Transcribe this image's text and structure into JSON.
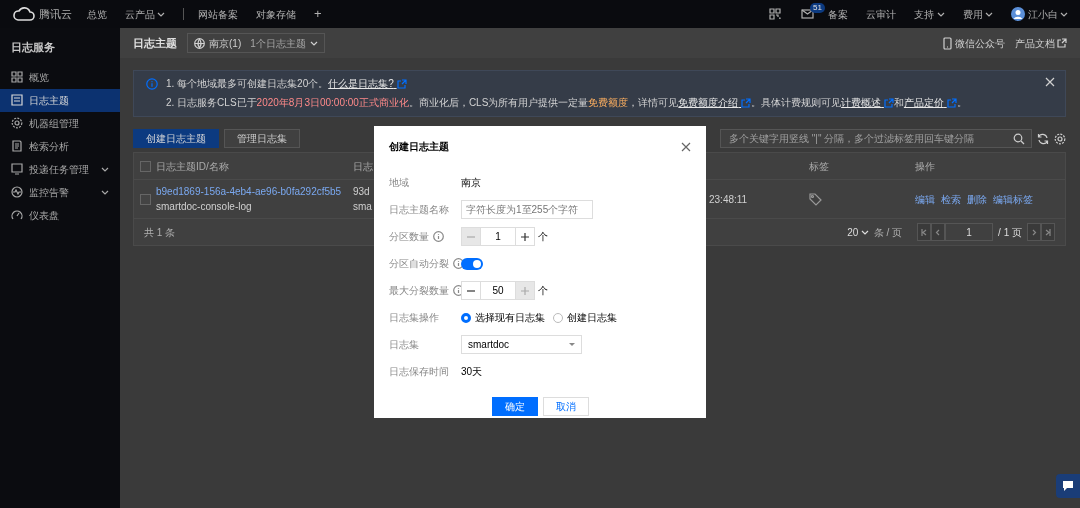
{
  "top_nav": {
    "logo": "腾讯云",
    "left_items": [
      {
        "label": "总览",
        "dropdown": false
      },
      {
        "label": "云产品",
        "dropdown": true
      }
    ],
    "shortcuts": [
      "网站备案",
      "对象存储"
    ],
    "add": "+",
    "mail_badge": "51",
    "right_items": [
      {
        "label": "备案",
        "dropdown": false
      },
      {
        "label": "云审计",
        "dropdown": false
      },
      {
        "label": "支持",
        "dropdown": true
      },
      {
        "label": "费用",
        "dropdown": true
      }
    ],
    "user": {
      "name": "江小白",
      "dropdown": true
    }
  },
  "sidebar": {
    "title": "日志服务",
    "items": [
      {
        "label": "概览",
        "selected": false,
        "expandable": false
      },
      {
        "label": "日志主题",
        "selected": true,
        "expandable": false
      },
      {
        "label": "机器组管理",
        "selected": false,
        "expandable": false
      },
      {
        "label": "检索分析",
        "selected": false,
        "expandable": false
      },
      {
        "label": "投递任务管理",
        "selected": false,
        "expandable": true
      },
      {
        "label": "监控告警",
        "selected": false,
        "expandable": true
      },
      {
        "label": "仪表盘",
        "selected": false,
        "expandable": false
      }
    ]
  },
  "page_header": {
    "title": "日志主题",
    "region": "南京(1)",
    "topic_count": "1个日志主题",
    "links": [
      {
        "label": "微信公众号",
        "kind": "phone"
      },
      {
        "label": "产品文档",
        "kind": "external"
      }
    ]
  },
  "notice": {
    "lines": [
      [
        {
          "kind": "plain",
          "text": "1. 每个地域最多可创建日志集20个。"
        },
        {
          "kind": "link",
          "text": "什么是日志集?"
        }
      ],
      [
        {
          "kind": "plain",
          "text": "2. 日志服务CLS已于"
        },
        {
          "kind": "red",
          "text": "2020年8月3日00:00:00正式商业化"
        },
        {
          "kind": "plain",
          "text": "。商业化后，CLS为所有用户提供一定量"
        },
        {
          "kind": "orange",
          "text": "免费额度"
        },
        {
          "kind": "plain",
          "text": "，详情可见"
        },
        {
          "kind": "link",
          "text": "免费额度介绍"
        },
        {
          "kind": "plain",
          "text": "。具体计费规则可见"
        },
        {
          "kind": "link",
          "text": "计费概述"
        },
        {
          "kind": "plain",
          "text": "和"
        },
        {
          "kind": "link",
          "text": "产品定价"
        },
        {
          "kind": "plain",
          "text": "。"
        }
      ]
    ]
  },
  "toolbar": {
    "buttons": [
      {
        "label": "创建日志主题",
        "primary": true
      },
      {
        "label": "管理日志集",
        "primary": false
      }
    ],
    "search": {
      "placeholder": "多个关键字用竖线 \"|\" 分隔，多个过滤标签用回车键分隔"
    }
  },
  "table": {
    "header_checked": false,
    "columns": [
      "日志主题ID/名称",
      "日志",
      "标签",
      "操作"
    ],
    "rows": [
      {
        "checked": false,
        "id": "b9ed1869-156a-4eb4-ae96-b0fa292cf5b5",
        "name": "smartdoc-console-log",
        "column_2": [
          "93d",
          "sma"
        ],
        "column_3": "23:48:11",
        "actions": [
          "编辑",
          "检索",
          "删除",
          "编辑标签"
        ]
      }
    ],
    "total": "共 1 条",
    "page_size": "20",
    "page_size_unit": "条 / 页",
    "page": "1",
    "page_total": "/ 1 页"
  },
  "dialog": {
    "title": "创建日志主题",
    "fields": [
      {
        "kind": "text",
        "label": "地域",
        "value": "南京"
      },
      {
        "kind": "input",
        "label": "日志主题名称",
        "placeholder": "字符长度为1至255个字符"
      },
      {
        "kind": "stepper",
        "label": "分区数量",
        "info": true,
        "value": "1",
        "minus_disabled": true,
        "plus_disabled": false,
        "unit": "个"
      },
      {
        "kind": "switch",
        "label": "分区自动分裂",
        "info": true,
        "on": true
      },
      {
        "kind": "stepper",
        "label": "最大分裂数量",
        "info": true,
        "value": "50",
        "minus_disabled": false,
        "plus_disabled": true,
        "unit": "个"
      },
      {
        "kind": "radio",
        "label": "日志集操作",
        "options": [
          {
            "label": "选择现有日志集",
            "selected": true
          },
          {
            "label": "创建日志集",
            "selected": false
          }
        ]
      },
      {
        "kind": "select",
        "label": "日志集",
        "value": "smartdoc"
      },
      {
        "kind": "text",
        "label": "日志保存时间",
        "value": "30天"
      }
    ],
    "buttons": [
      {
        "label": "确定",
        "primary": true
      },
      {
        "label": "取消",
        "primary": false
      }
    ]
  }
}
